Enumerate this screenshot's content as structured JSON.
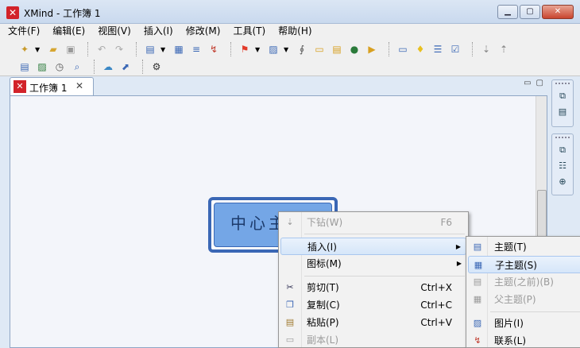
{
  "window": {
    "title": "XMind - 工作簿 1",
    "app_icon": "xmind-logo-icon",
    "controls": [
      "minimize-icon",
      "maximize-icon",
      "close-icon"
    ]
  },
  "menubar": [
    "文件(F)",
    "编辑(E)",
    "视图(V)",
    "插入(I)",
    "修改(M)",
    "工具(T)",
    "帮助(H)"
  ],
  "toolbar": {
    "row1": [
      "new-icon",
      "open-folder-icon",
      "save-icon",
      "undo-icon",
      "redo-icon",
      "insert-topic-icon",
      "boundary-icon",
      "summary-icon",
      "relationship-icon",
      "flag-marker-icon",
      "image-icon",
      "attachment-icon",
      "label-icon",
      "notes-icon",
      "hyperlink-globe-icon",
      "audio-icon",
      "presentation-icon",
      "idea-bulb-icon",
      "outline-icon",
      "task-icon",
      "drill-down-icon",
      "drill-up-icon"
    ],
    "row2": [
      "sheet-icon",
      "picture-icon",
      "clock-icon",
      "search-icon",
      "upload-cloud-icon",
      "export-icon",
      "gear-icon"
    ]
  },
  "tab": {
    "label": "工作簿 1",
    "close": "✕"
  },
  "canvas": {
    "central_topic": "中心主题"
  },
  "context_menu": {
    "items": [
      {
        "label": "下钻(W)",
        "shortcut": "F6",
        "icon": "drill-down-icon",
        "enabled": false
      },
      {
        "label": "插入(I)",
        "shortcut": "",
        "icon": "",
        "enabled": true,
        "submenu": true
      },
      {
        "label": "图标(M)",
        "shortcut": "",
        "icon": "",
        "enabled": true,
        "submenu": true
      },
      {
        "label": "剪切(T)",
        "shortcut": "Ctrl+X",
        "icon": "scissors-icon",
        "enabled": true
      },
      {
        "label": "复制(C)",
        "shortcut": "Ctrl+C",
        "icon": "copy-icon",
        "enabled": true
      },
      {
        "label": "粘贴(P)",
        "shortcut": "Ctrl+V",
        "icon": "paste-icon",
        "enabled": true
      },
      {
        "label": "副本(L)",
        "shortcut": "",
        "icon": "duplicate-icon",
        "enabled": false
      }
    ]
  },
  "submenu": {
    "items": [
      {
        "label": "主题(T)",
        "icon": "topic-icon",
        "enabled": true
      },
      {
        "label": "子主题(S)",
        "icon": "subtopic-icon",
        "enabled": true,
        "highlighted": true
      },
      {
        "label": "主题(之前)(B)",
        "icon": "topic-before-icon",
        "enabled": false
      },
      {
        "label": "父主题(P)",
        "icon": "parent-topic-icon",
        "enabled": false
      },
      {
        "label": "图片(I)",
        "icon": "image-icon",
        "enabled": true
      },
      {
        "label": "联系(L)",
        "icon": "relationship-icon",
        "enabled": true
      }
    ]
  },
  "colors": {
    "accent": "#3a67b5",
    "topic_fill": "#74a6e6",
    "brand_red": "#d2232a"
  }
}
